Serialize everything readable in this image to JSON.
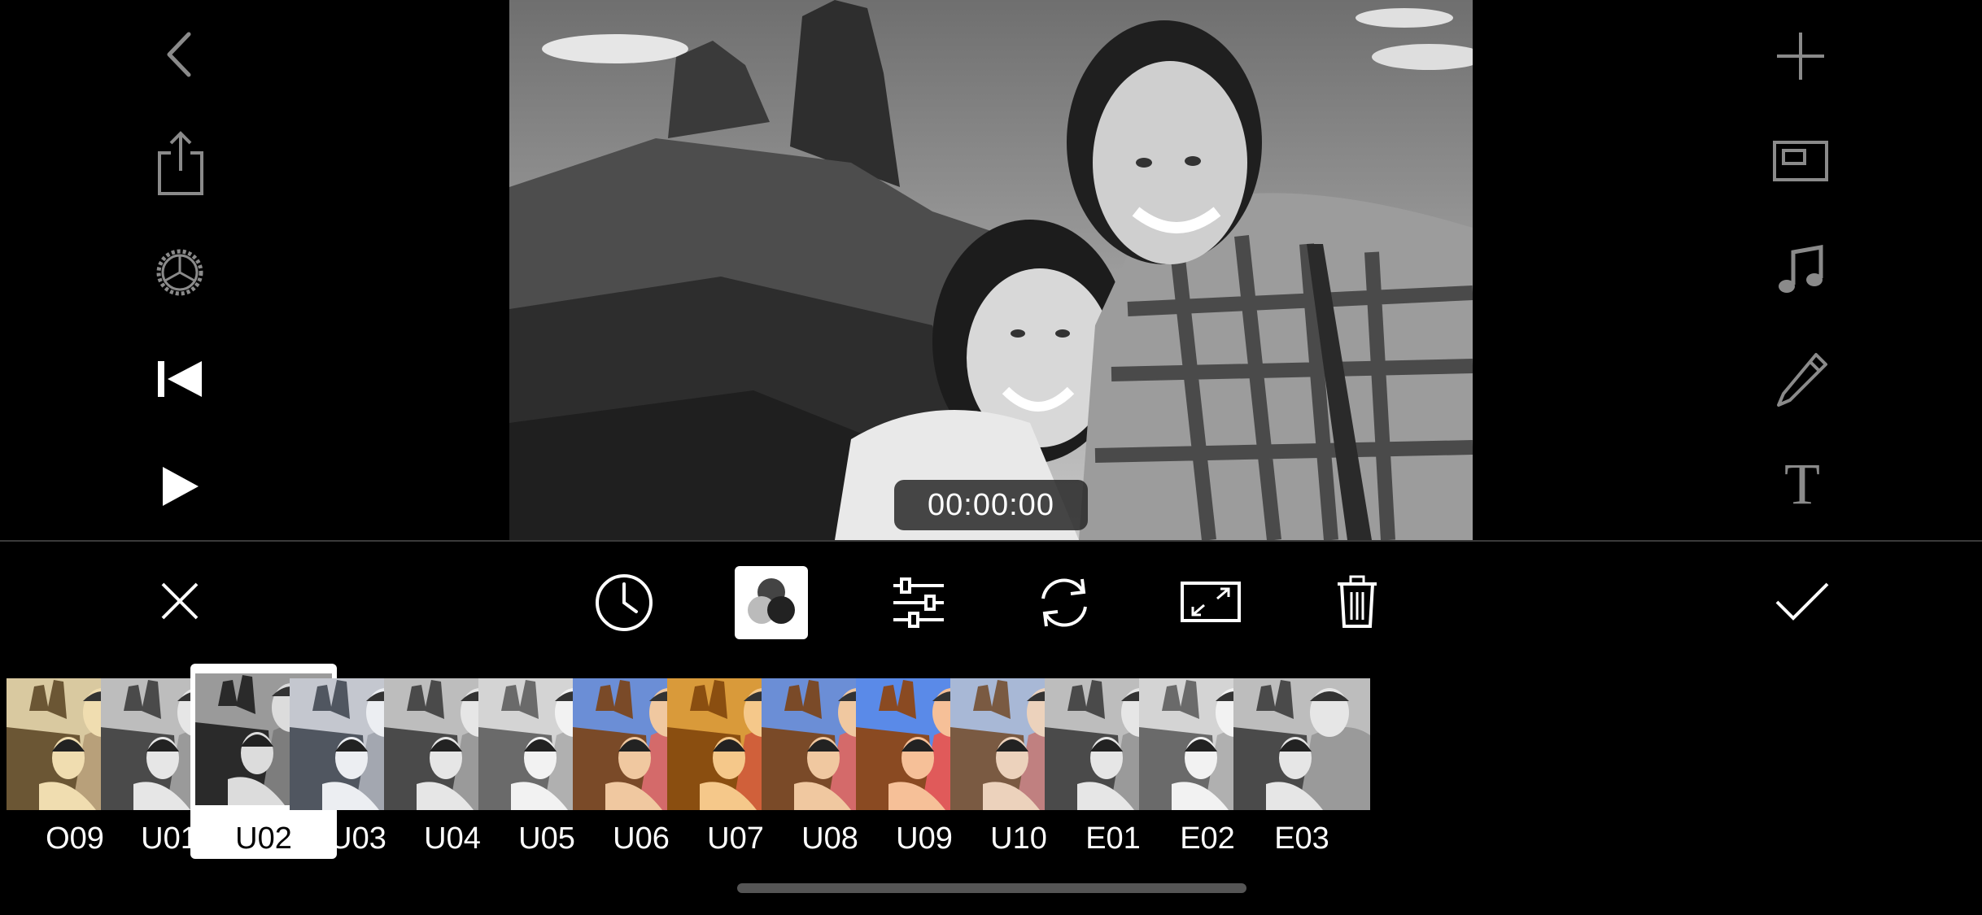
{
  "app": {
    "timecode": "00:00:00"
  },
  "left_toolbar": {
    "icons": [
      "back-chevron-icon",
      "share-icon",
      "settings-gear-icon",
      "skip-to-start-icon",
      "play-icon"
    ]
  },
  "right_toolbar": {
    "icons": [
      "add-icon",
      "aspect-ratio-icon",
      "music-icon",
      "pencil-icon",
      "text-icon"
    ],
    "text_glyph": "T"
  },
  "bottom_toolbar": {
    "icons": [
      "close-icon",
      "clock-icon",
      "filter-icon",
      "adjust-sliders-icon",
      "rotate-icon",
      "resize-icon",
      "trash-icon",
      "checkmark-icon"
    ],
    "selected": "filter-icon"
  },
  "filters": {
    "selected": "U02",
    "items": [
      {
        "label": "O09",
        "tone": "sepia"
      },
      {
        "label": "U01",
        "tone": "bw"
      },
      {
        "label": "U02",
        "tone": "bw-contrast"
      },
      {
        "label": "U03",
        "tone": "bw-cool"
      },
      {
        "label": "U04",
        "tone": "bw"
      },
      {
        "label": "U05",
        "tone": "bw-light"
      },
      {
        "label": "U06",
        "tone": "color-warm"
      },
      {
        "label": "U07",
        "tone": "color-orange"
      },
      {
        "label": "U08",
        "tone": "color-warm"
      },
      {
        "label": "U09",
        "tone": "color-vivid"
      },
      {
        "label": "U10",
        "tone": "color-soft"
      },
      {
        "label": "E01",
        "tone": "bw"
      },
      {
        "label": "E02",
        "tone": "bw-light"
      },
      {
        "label": "E03",
        "tone": "bw"
      }
    ]
  },
  "colors": {
    "background": "#000000",
    "icon_gray": "#8a8a8a",
    "icon_white": "#ffffff",
    "selection": "#ffffff"
  }
}
